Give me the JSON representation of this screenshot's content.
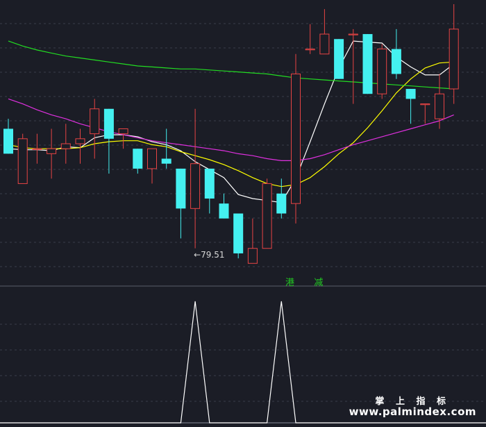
{
  "chart_data": [
    {
      "type": "candlestick",
      "panel": "main",
      "title": "",
      "grid": true,
      "ylim": [
        76,
        104
      ],
      "colors": {
        "up": "#e84444",
        "down": "#44f0f0",
        "background": "#1b1d26",
        "grid": "#3a3d4a"
      },
      "candles": [
        {
          "o": 91.5,
          "h": 92.5,
          "l": 89.0,
          "c": 89.0
        },
        {
          "o": 86.0,
          "h": 91.0,
          "l": 86.0,
          "c": 90.5
        },
        {
          "o": 89.5,
          "h": 91.0,
          "l": 88.0,
          "c": 89.5
        },
        {
          "o": 89.0,
          "h": 91.5,
          "l": 86.5,
          "c": 89.5
        },
        {
          "o": 89.5,
          "h": 92.0,
          "l": 88.0,
          "c": 90.0
        },
        {
          "o": 90.0,
          "h": 91.5,
          "l": 88.0,
          "c": 90.5
        },
        {
          "o": 91.0,
          "h": 94.5,
          "l": 88.5,
          "c": 93.5
        },
        {
          "o": 93.5,
          "h": 93.5,
          "l": 87.0,
          "c": 90.5
        },
        {
          "o": 91.0,
          "h": 91.5,
          "l": 89.5,
          "c": 91.5
        },
        {
          "o": 89.5,
          "h": 89.5,
          "l": 87.0,
          "c": 87.5
        },
        {
          "o": 87.5,
          "h": 89.5,
          "l": 86.0,
          "c": 89.5
        },
        {
          "o": 88.5,
          "h": 91.5,
          "l": 87.5,
          "c": 88.0
        },
        {
          "o": 87.5,
          "h": 87.5,
          "l": 80.5,
          "c": 83.5
        },
        {
          "o": 83.5,
          "h": 93.5,
          "l": 79.51,
          "c": 88.0
        },
        {
          "o": 87.5,
          "h": 87.5,
          "l": 83.0,
          "c": 84.5
        },
        {
          "o": 84.0,
          "h": 85.0,
          "l": 82.5,
          "c": 82.5
        },
        {
          "o": 83.0,
          "h": 83.0,
          "l": 78.5,
          "c": 79.0
        },
        {
          "o": 78.0,
          "h": 82.5,
          "l": 78.0,
          "c": 79.5
        },
        {
          "o": 79.5,
          "h": 86.5,
          "l": 79.5,
          "c": 86.0
        },
        {
          "o": 85.0,
          "h": 86.5,
          "l": 82.5,
          "c": 83.0
        },
        {
          "o": 84.0,
          "h": 99.0,
          "l": 82.0,
          "c": 97.0
        },
        {
          "o": 99.5,
          "h": 102.0,
          "l": 99.0,
          "c": 99.5
        },
        {
          "o": 99.0,
          "h": 103.5,
          "l": 99.0,
          "c": 101.0
        },
        {
          "o": 100.5,
          "h": 100.5,
          "l": 96.5,
          "c": 96.5
        },
        {
          "o": 101.0,
          "h": 101.5,
          "l": 94.0,
          "c": 101.0
        },
        {
          "o": 101.0,
          "h": 101.0,
          "l": 95.0,
          "c": 95.0
        },
        {
          "o": 95.0,
          "h": 100.0,
          "l": 94.5,
          "c": 99.5
        },
        {
          "o": 99.5,
          "h": 101.5,
          "l": 96.5,
          "c": 97.0
        },
        {
          "o": 95.5,
          "h": 95.5,
          "l": 92.0,
          "c": 94.5
        },
        {
          "o": 94.0,
          "h": 94.0,
          "l": 92.0,
          "c": 94.0
        },
        {
          "o": 92.5,
          "h": 97.0,
          "l": 91.5,
          "c": 95.0
        },
        {
          "o": 95.5,
          "h": 104.0,
          "l": 94.0,
          "c": 101.5
        }
      ],
      "series": [
        {
          "color": "#ffffff",
          "values": [
            89.5,
            89.4,
            89.4,
            89.3,
            89.7,
            89.6,
            90.6,
            90.9,
            90.9,
            90.7,
            90.2,
            89.9,
            89.3,
            88.2,
            87.4,
            86.6,
            84.9,
            84.5,
            84.3,
            84.1,
            86.5,
            90.2,
            94.0,
            97.6,
            100.3,
            100.2,
            100.1,
            98.7,
            97.7,
            96.9,
            96.9,
            98.0
          ]
        },
        {
          "color": "#ffff00",
          "values": [
            89.9,
            89.6,
            89.5,
            89.5,
            89.5,
            89.6,
            90.0,
            90.2,
            90.3,
            90.3,
            89.9,
            89.7,
            89.2,
            88.8,
            88.4,
            87.9,
            87.3,
            86.6,
            86.0,
            85.7,
            85.9,
            86.6,
            87.7,
            89.0,
            90.1,
            91.6,
            93.3,
            95.1,
            96.5,
            97.6,
            98.1,
            98.2
          ]
        },
        {
          "color": "#e030e0",
          "values": [
            94.5,
            94.0,
            93.4,
            92.9,
            92.5,
            92.0,
            91.6,
            91.2,
            90.9,
            90.6,
            90.3,
            90.1,
            89.9,
            89.7,
            89.5,
            89.3,
            89.0,
            88.8,
            88.5,
            88.3,
            88.3,
            88.5,
            88.9,
            89.4,
            89.9,
            90.3,
            90.7,
            91.1,
            91.5,
            91.9,
            92.3,
            92.9
          ]
        },
        {
          "color": "#22dd22",
          "values": [
            100.3,
            99.8,
            99.4,
            99.1,
            98.8,
            98.6,
            98.4,
            98.2,
            98.0,
            97.8,
            97.7,
            97.6,
            97.5,
            97.5,
            97.4,
            97.3,
            97.2,
            97.1,
            97.0,
            96.8,
            96.6,
            96.5,
            96.4,
            96.3,
            96.2,
            96.1,
            96.0,
            95.9,
            95.8,
            95.7,
            95.6,
            95.5
          ]
        }
      ],
      "annotations": [
        {
          "text": "←79.51",
          "candle": 13,
          "y": 79.51
        },
        {
          "text": "港",
          "candle": 20
        },
        {
          "text": "减",
          "candle": 22
        }
      ]
    },
    {
      "type": "line",
      "panel": "indicator",
      "title": "",
      "grid": true,
      "ylim": [
        0,
        1
      ],
      "series": [
        {
          "color": "#ffffff",
          "values": [
            0,
            0,
            0,
            0,
            0,
            0,
            0,
            0,
            0,
            0,
            0,
            0,
            0,
            1,
            0,
            0,
            0,
            0,
            0,
            1,
            0,
            0,
            0,
            0,
            0,
            0,
            0,
            0,
            0,
            0,
            0,
            0
          ]
        }
      ]
    }
  ],
  "watermark": {
    "line1": "掌 上 指 标",
    "line2": "www.palmindex.com"
  }
}
